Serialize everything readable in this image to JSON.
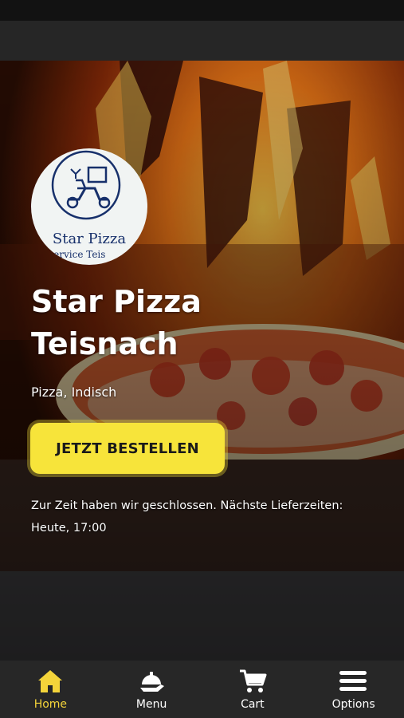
{
  "restaurant": {
    "logo_name": "Star Pizza",
    "logo_subtitle": "servіce Teis",
    "name": "Star Pizza Teisnach",
    "cuisine": "Pizza, Indisch"
  },
  "order_button": {
    "label": "JETZT BESTELLEN"
  },
  "status": {
    "closed_text": "Zur Zeit haben wir geschlossen. Nächste Lieferzeiten: Heute, 17:00"
  },
  "nav": {
    "items": [
      {
        "label": "Home",
        "icon": "home-icon",
        "active": true
      },
      {
        "label": "Menu",
        "icon": "cloche-icon",
        "active": false
      },
      {
        "label": "Cart",
        "icon": "cart-icon",
        "active": false
      },
      {
        "label": "Options",
        "icon": "hamburger-menu-icon",
        "active": false
      }
    ]
  },
  "colors": {
    "accent": "#f7e43a",
    "active_nav": "#f4d43a",
    "nav_bg": "#272727",
    "logo_text": "#17306b"
  }
}
